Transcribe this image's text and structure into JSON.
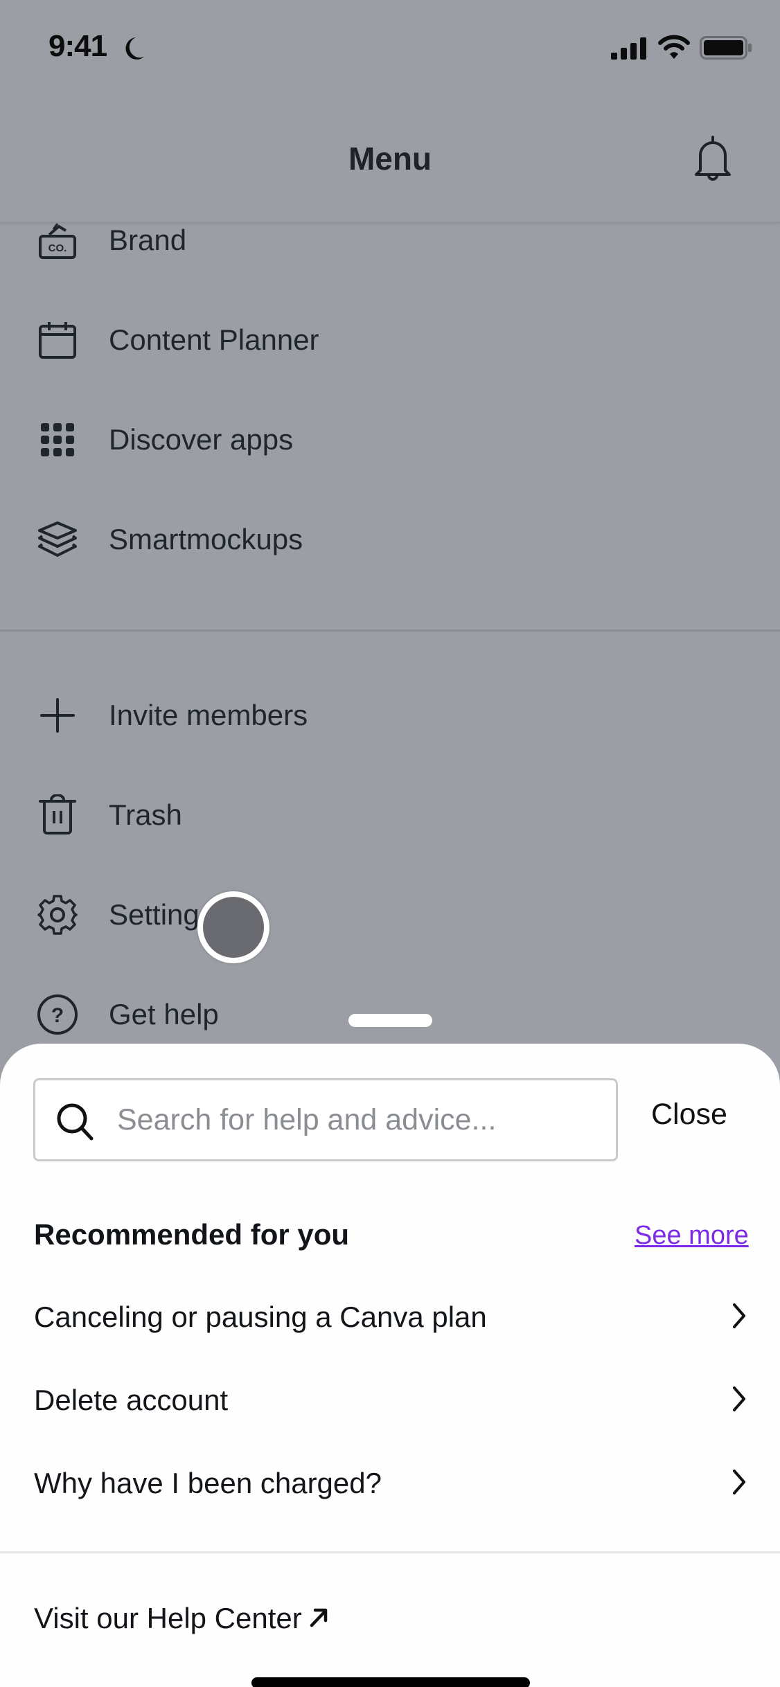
{
  "status_bar": {
    "time": "9:41",
    "icons": [
      "moon-icon",
      "cellular-signal-icon",
      "wifi-icon",
      "battery-icon"
    ]
  },
  "header": {
    "title": "Menu",
    "notification_icon": "bell-icon"
  },
  "menu": {
    "section1": [
      {
        "label": "Brand",
        "icon": "brand-kit-icon"
      },
      {
        "label": "Content Planner",
        "icon": "calendar-icon"
      },
      {
        "label": "Discover apps",
        "icon": "apps-grid-icon"
      },
      {
        "label": "Smartmockups",
        "icon": "layers-icon"
      }
    ],
    "section2": [
      {
        "label": "Invite members",
        "icon": "plus-icon"
      },
      {
        "label": "Trash",
        "icon": "trash-icon"
      },
      {
        "label": "Settings",
        "icon": "gear-icon"
      },
      {
        "label": "Get help",
        "icon": "help-circle-icon"
      }
    ]
  },
  "help_sheet": {
    "search": {
      "placeholder": "Search for help and advice...",
      "value": ""
    },
    "close_label": "Close",
    "recommended_title": "Recommended for you",
    "see_more_label": "See more",
    "recommended_items": [
      {
        "label": "Canceling or pausing a Canva plan"
      },
      {
        "label": "Delete account"
      },
      {
        "label": "Why have I been charged?"
      }
    ],
    "help_center_label": "Visit our Help Center"
  },
  "colors": {
    "overlay": "#9b9ea4",
    "accent_link": "#7d2ae8",
    "sheet_bg": "#fefefe"
  }
}
